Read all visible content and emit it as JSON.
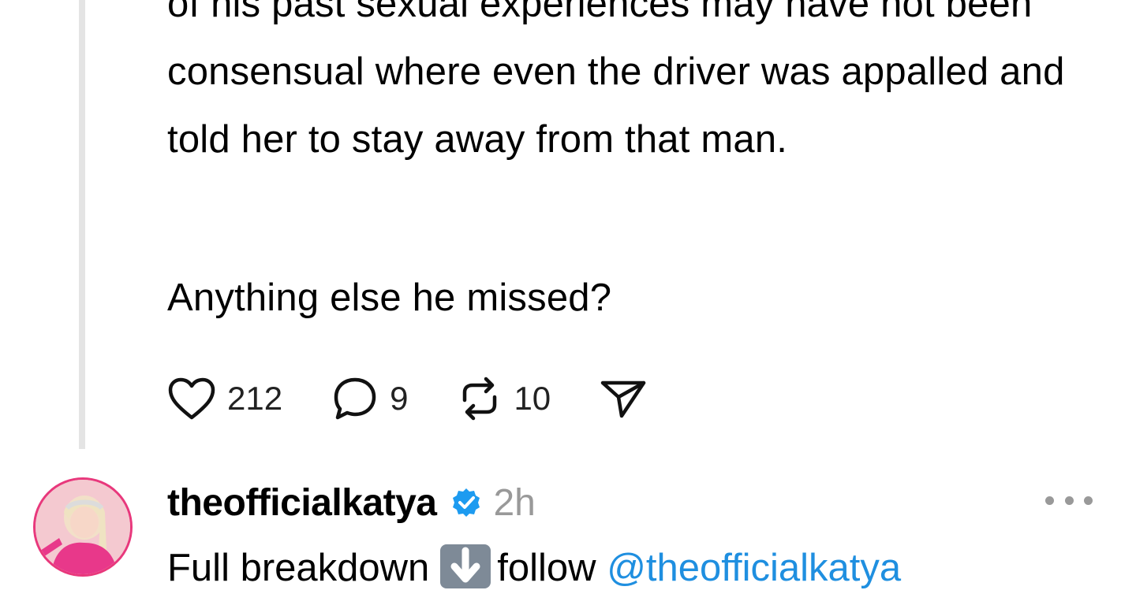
{
  "post": {
    "paragraph1": "of his past sexual experiences may have not been consensual where even the driver was appalled and told her to stay away from that man.",
    "paragraph2": "Anything else he missed?",
    "likes": "212",
    "replies": "9",
    "reposts": "10"
  },
  "reply": {
    "username": "theofficialkatya",
    "time": "2h",
    "text_before": "Full breakdown",
    "emoji": "down-arrow-emoji",
    "text_after": "follow",
    "mention": "@theofficialkatya"
  },
  "icons": {
    "like": "heart-icon",
    "reply": "comment-icon",
    "repost": "repost-icon",
    "share": "send-icon",
    "verified": "verified-badge-icon",
    "more": "more-options-icon"
  },
  "colors": {
    "link": "#1f8fe0",
    "verified": "#1d9bf0",
    "muted": "#999999",
    "avatar_ring": "#e8387c"
  }
}
